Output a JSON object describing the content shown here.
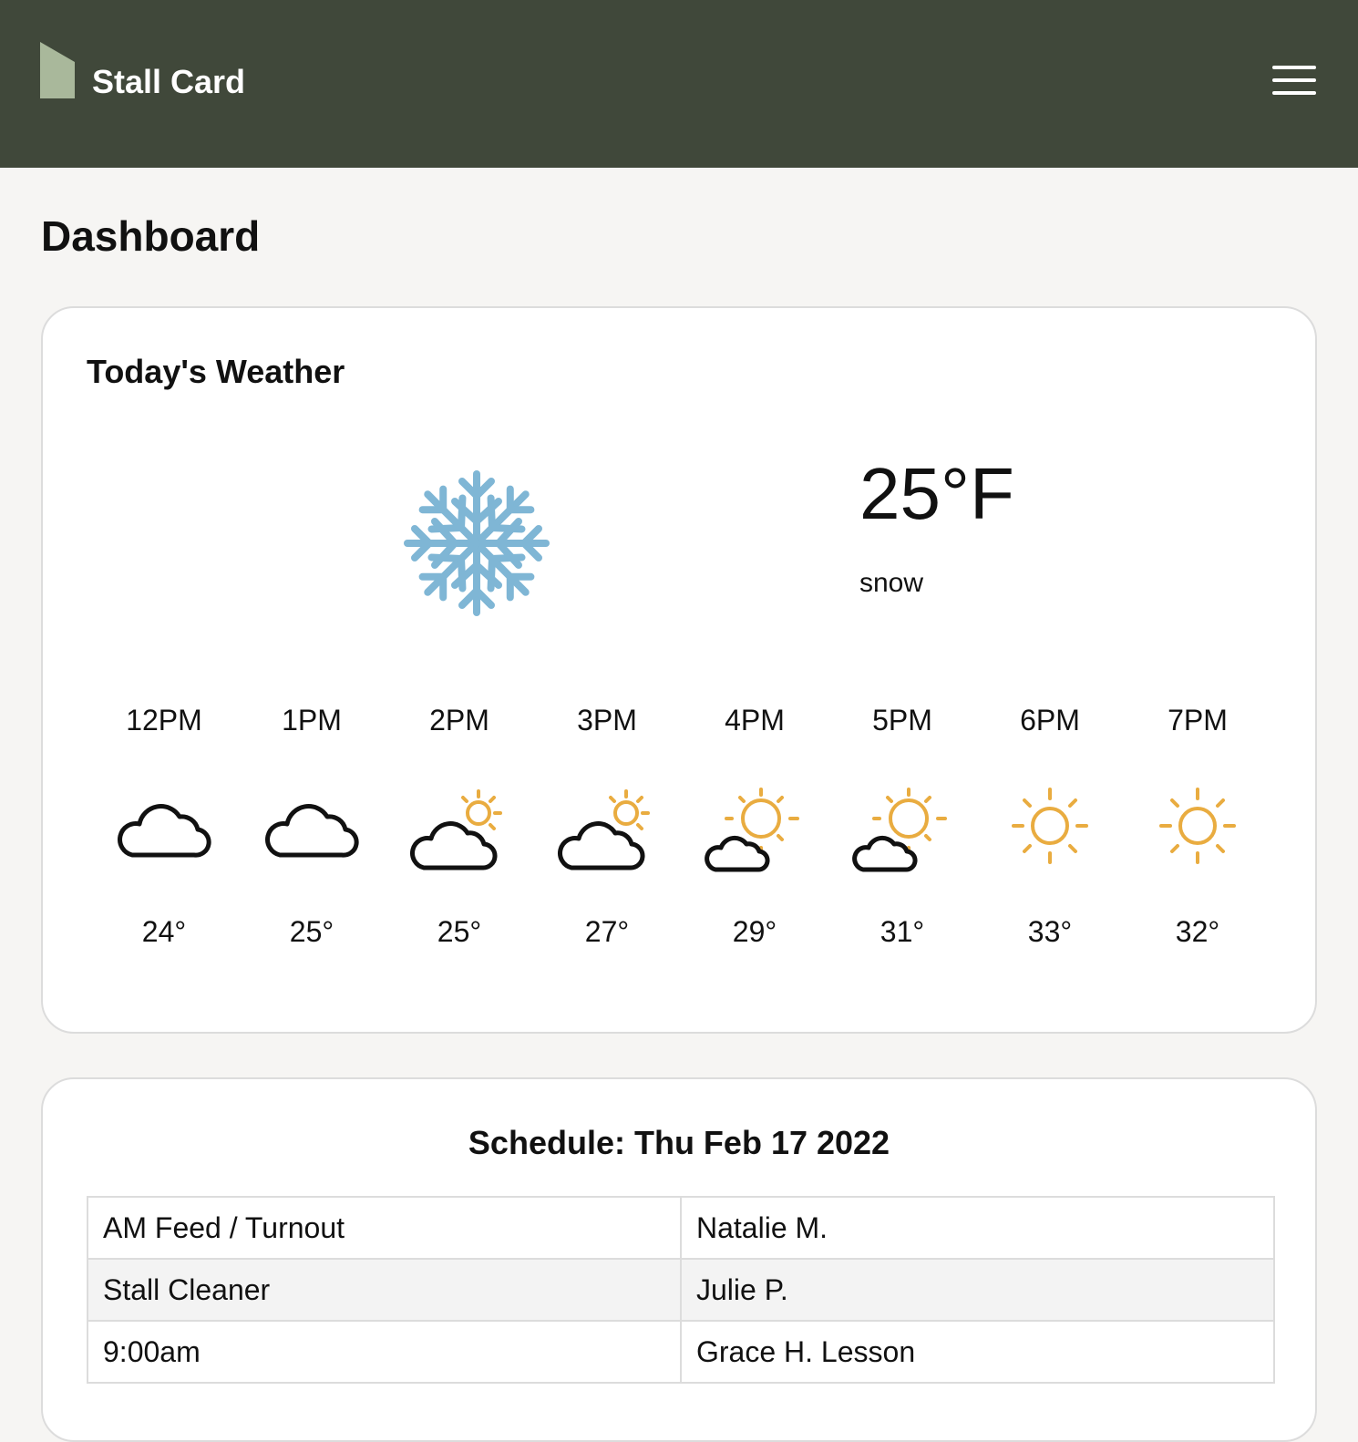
{
  "header": {
    "brand": "Stall Card",
    "logo_color": "#a9b89b",
    "menu_icon": "hamburger-menu-icon"
  },
  "page": {
    "title": "Dashboard"
  },
  "weather": {
    "title": "Today's Weather",
    "current": {
      "temperature": "25°F",
      "condition": "snow",
      "icon": "snowflake-icon"
    },
    "hourly": [
      {
        "time": "12PM",
        "temp": "24°",
        "icon": "cloud-icon"
      },
      {
        "time": "1PM",
        "temp": "25°",
        "icon": "cloud-icon"
      },
      {
        "time": "2PM",
        "temp": "25°",
        "icon": "mostly-cloudy-icon"
      },
      {
        "time": "3PM",
        "temp": "27°",
        "icon": "mostly-cloudy-icon"
      },
      {
        "time": "4PM",
        "temp": "29°",
        "icon": "partly-cloudy-icon"
      },
      {
        "time": "5PM",
        "temp": "31°",
        "icon": "partly-cloudy-icon"
      },
      {
        "time": "6PM",
        "temp": "33°",
        "icon": "sun-icon"
      },
      {
        "time": "7PM",
        "temp": "32°",
        "icon": "sun-icon"
      }
    ],
    "colors": {
      "snow": "#7fb6d5",
      "sun": "#e9ac40",
      "cloud": "#111111"
    }
  },
  "schedule": {
    "title": "Schedule: Thu Feb 17 2022",
    "rows": [
      {
        "task": "AM Feed / Turnout",
        "person": "Natalie M."
      },
      {
        "task": "Stall Cleaner",
        "person": "Julie P."
      },
      {
        "task": "9:00am",
        "person": "Grace H. Lesson"
      }
    ]
  }
}
